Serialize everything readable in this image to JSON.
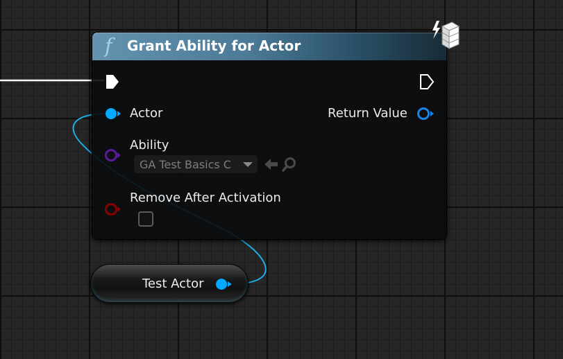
{
  "node": {
    "title": "Grant Ability for Actor",
    "function_icon": "f",
    "badge_icon": "authority-only-icon",
    "inputs": {
      "actor_label": "Actor",
      "ability_label": "Ability",
      "ability_value": "GA Test Basics C",
      "remove_after_activation_label": "Remove After Activation",
      "remove_after_activation_checked": false
    },
    "outputs": {
      "return_value_label": "Return Value"
    }
  },
  "variable_node": {
    "label": "Test Actor"
  },
  "colors": {
    "object_pin": "#00a9ff",
    "class_pin": "#5b1b9b",
    "bool_pin": "#8a0000",
    "exec_pin": "#ffffff",
    "wire": "#1eaee8",
    "header": "#4b7996"
  }
}
